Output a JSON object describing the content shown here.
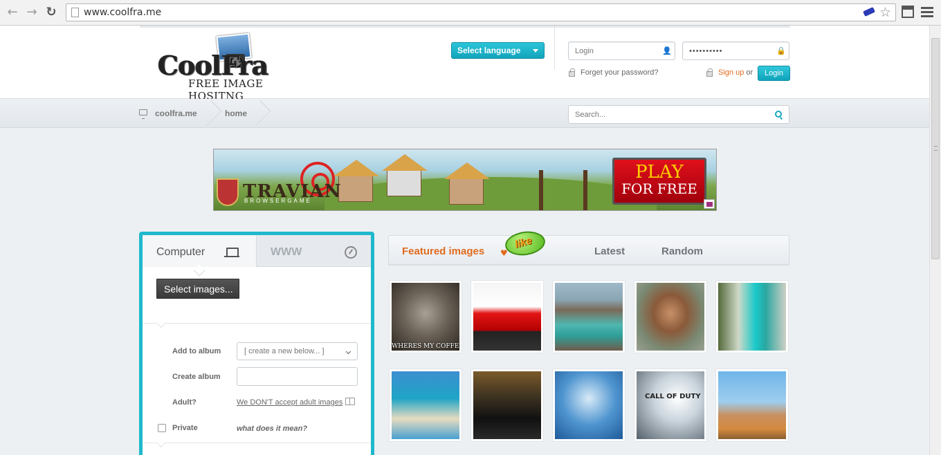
{
  "browser": {
    "url": "www.coolfra.me"
  },
  "header": {
    "logo_title": "CoolFra",
    "logo_subtitle": "FREE IMAGE HOSITNG",
    "language_button": "Select language",
    "login_placeholder": "Login",
    "password_value": "••••••••••",
    "forgot_password": "Forget your password?",
    "signup_link": "Sign up",
    "signup_or": "or",
    "login_button": "Login"
  },
  "breadcrumb": {
    "items": [
      "coolfra.me",
      "home"
    ],
    "search_placeholder": "Search..."
  },
  "ad": {
    "brand": "TRAVIAN",
    "brand_sub": "BROWSERGAME",
    "cta_line1": "PLAY",
    "cta_line2": "FOR FREE"
  },
  "upload": {
    "tab_computer": "Computer",
    "tab_www": "WWW",
    "select_button": "Select images...",
    "add_to_album_label": "Add to album",
    "album_select_value": "[ create a new below... ]",
    "create_album_label": "Create album",
    "adult_label": "Adult?",
    "adult_link": "We DON'T accept adult images",
    "private_label": "Private",
    "private_help": "what does it mean?"
  },
  "featured": {
    "tab_featured": "Featured images",
    "like_badge": "like",
    "tab_latest": "Latest",
    "tab_random": "Random",
    "thumbnails": [
      {
        "name": "cat",
        "caption": "WHERES MY COFFEE"
      },
      {
        "name": "red-mustang",
        "caption": ""
      },
      {
        "name": "crater-lake",
        "caption": ""
      },
      {
        "name": "woman",
        "caption": ""
      },
      {
        "name": "canyon-river",
        "caption": ""
      },
      {
        "name": "beach",
        "caption": ""
      },
      {
        "name": "black-mustang",
        "caption": ""
      },
      {
        "name": "ufo-plane",
        "caption": ""
      },
      {
        "name": "call-of-duty",
        "caption": "CALL OF DUTY"
      },
      {
        "name": "coastal-town",
        "caption": ""
      }
    ]
  }
}
